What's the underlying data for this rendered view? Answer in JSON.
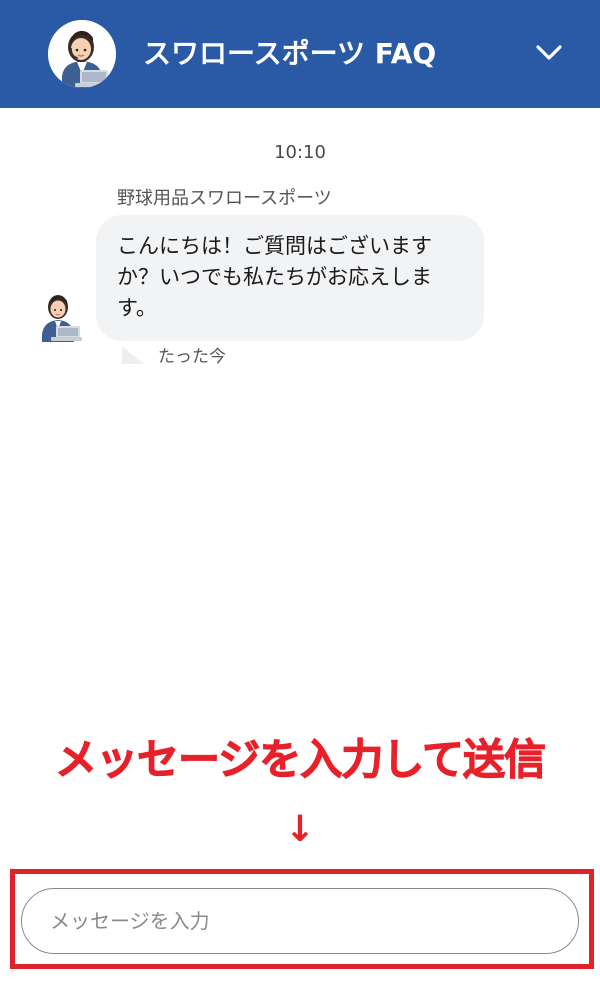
{
  "header": {
    "title": "スワロースポーツ FAQ",
    "background_color": "#2a5aa6",
    "avatar_icon": "support-agent-avatar-icon",
    "collapse_icon": "chevron-down-icon"
  },
  "chat": {
    "timestamp": "10:10",
    "messages": [
      {
        "sender": "野球用品スワロースポーツ",
        "text": "こんにちは！ご質問はございますか？いつでも私たちがお応えします。",
        "time": "たった今",
        "avatar_icon": "support-agent-avatar-icon"
      }
    ]
  },
  "annotation": {
    "instruction": "メッセージを入力して送信",
    "arrow": "↓",
    "color": "#e8202a"
  },
  "composer": {
    "placeholder": "メッセージを入力",
    "value": ""
  }
}
